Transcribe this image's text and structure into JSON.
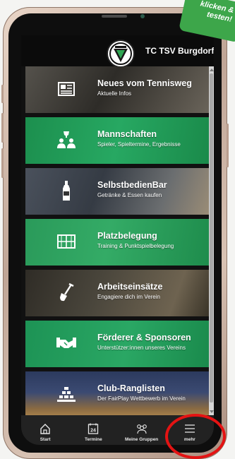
{
  "header": {
    "club_name": "TC TSV Burgdorf"
  },
  "promo": {
    "line1": "klicken &",
    "line2": "testen!"
  },
  "tiles": [
    {
      "title": "Neues vom Tennisweg",
      "subtitle": "Aktuelle Infos",
      "icon": "newspaper-icon",
      "color": "#3c3a36"
    },
    {
      "title": "Mannschaften",
      "subtitle": "Spieler, Spieltermine, Ergebnisse",
      "icon": "team-trophy-icon",
      "color": "#1e9a58"
    },
    {
      "title": "SelbstbedienBar",
      "subtitle": "Getränke & Essen kaufen",
      "icon": "bottle-icon",
      "color": "#3f4650"
    },
    {
      "title": "Platzbelegung",
      "subtitle": "Training & Punktspielbelegung",
      "icon": "court-grid-icon",
      "color": "#24a05c"
    },
    {
      "title": "Arbeitseinsätze",
      "subtitle": "Engagiere dich im Verein",
      "icon": "shovel-icon",
      "color": "#3e3a32"
    },
    {
      "title": "Förderer & Sponsoren",
      "subtitle": "Unterstützer:innen unseres Vereins",
      "icon": "handshake-icon",
      "color": "#1f9c5c"
    },
    {
      "title": "Club-Ranglisten",
      "subtitle": "Der FairPlay Wettbewerb im Verein",
      "icon": "ranking-pyramid-icon",
      "color": "#3a3f56"
    }
  ],
  "tabbar": {
    "tabs": [
      {
        "label": "Start",
        "icon": "home-icon"
      },
      {
        "label": "Termine",
        "icon": "calendar-icon",
        "icon_text": "24"
      },
      {
        "label": "Meine Gruppen",
        "icon": "groups-icon"
      },
      {
        "label": "mehr",
        "icon": "menu-icon"
      }
    ]
  },
  "colors": {
    "highlight_circle": "#e41313",
    "promo_badge": "#3da64a"
  }
}
